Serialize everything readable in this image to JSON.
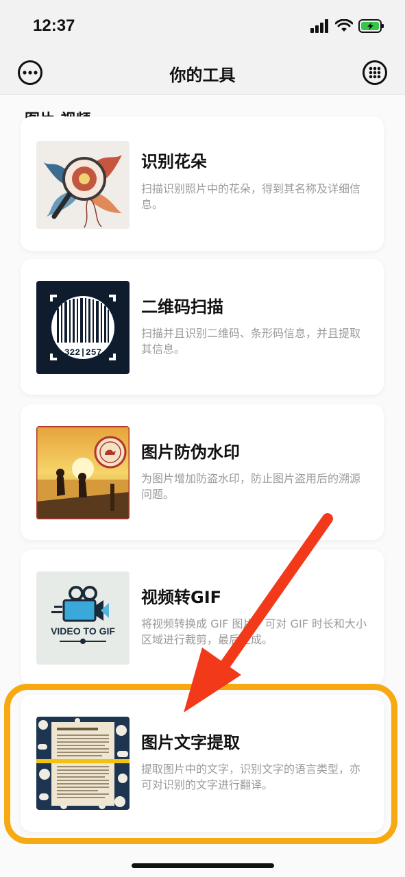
{
  "status_bar": {
    "time": "12:37"
  },
  "nav": {
    "title": "你的工具"
  },
  "section": {
    "title": "图片·视频"
  },
  "tools": [
    {
      "title": "识别花朵",
      "description": "扫描识别照片中的花朵，得到其名称及详细信息。",
      "icon": "flower-magnifier-thumbnail"
    },
    {
      "title": "二维码扫描",
      "description": "扫描并且识别二维码、条形码信息，并且提取其信息。",
      "icon": "barcode-thumbnail",
      "barcode_text": "322|257"
    },
    {
      "title": "图片防伪水印",
      "description": "为图片增加防盗水印，防止图片盗用后的溯源问题。",
      "icon": "sunset-watermark-thumbnail"
    },
    {
      "title": "视频转GIF",
      "description": "将视频转换成 GIF 图片，可对 GIF 时长和大小区域进行裁剪，最后生成。",
      "icon": "video-to-gif-thumbnail",
      "logo_text": "VIDEO TO GIF"
    },
    {
      "title": "图片文字提取",
      "description": "提取图片中的文字，识别文字的语言类型，亦可对识别的文字进行翻译。",
      "icon": "document-scan-thumbnail"
    }
  ],
  "colors": {
    "highlight": "#f7a912",
    "arrow": "#f23a1a"
  }
}
